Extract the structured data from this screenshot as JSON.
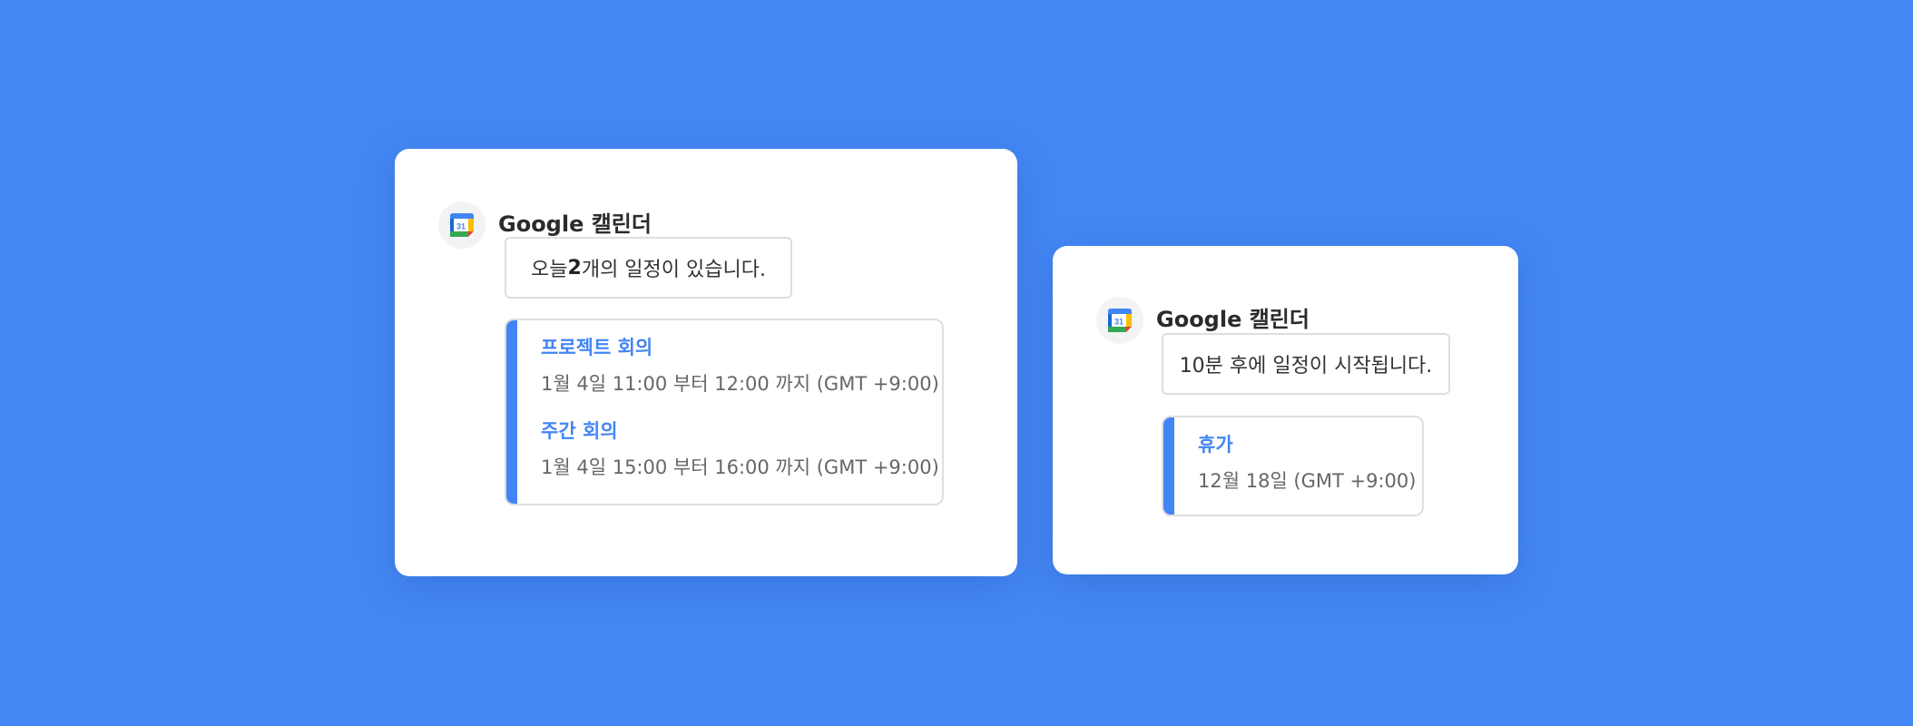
{
  "notifications": [
    {
      "app_name": "Google 캘린더",
      "calendar_day": "31",
      "message": {
        "before": "오늘 ",
        "bold": "2",
        "after": "개의 일정이 있습니다."
      },
      "events": [
        {
          "title": "프로젝트 회의",
          "time": "1월 4일 11:00 부터 12:00 까지 (GMT +9:00)"
        },
        {
          "title": "주간 회의",
          "time": "1월 4일 15:00 부터 16:00 까지 (GMT +9:00)"
        }
      ]
    },
    {
      "app_name": "Google 캘린더",
      "calendar_day": "31",
      "message": {
        "before": "10분 후에 일정이 시작됩니다.",
        "bold": "",
        "after": ""
      },
      "events": [
        {
          "title": "휴가",
          "time": "12월 18일 (GMT +9:00)"
        }
      ]
    }
  ],
  "colors": {
    "background": "#4487f4",
    "accent": "#4285f4",
    "card": "#ffffff"
  }
}
